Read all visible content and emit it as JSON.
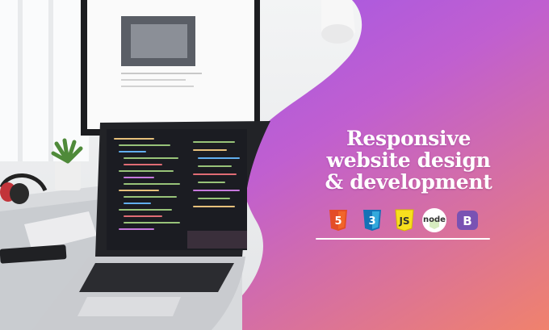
{
  "headline": {
    "line1": "Responsive",
    "line2": "website design",
    "line3": "& development"
  },
  "tech_icons": [
    {
      "name": "html5-icon",
      "label": "5",
      "color": "#e44d26"
    },
    {
      "name": "css3-icon",
      "label": "3",
      "color": "#1572b6"
    },
    {
      "name": "javascript-icon",
      "label": "JS",
      "color": "#f7df1e"
    },
    {
      "name": "nodejs-icon",
      "label": "node",
      "color": "#539e43"
    },
    {
      "name": "bootstrap-icon",
      "label": "B",
      "color": "#7952b3"
    }
  ],
  "colors": {
    "gradient_start": "#8e52f5",
    "gradient_mid": "#c05fd0",
    "gradient_end": "#f0826c"
  }
}
